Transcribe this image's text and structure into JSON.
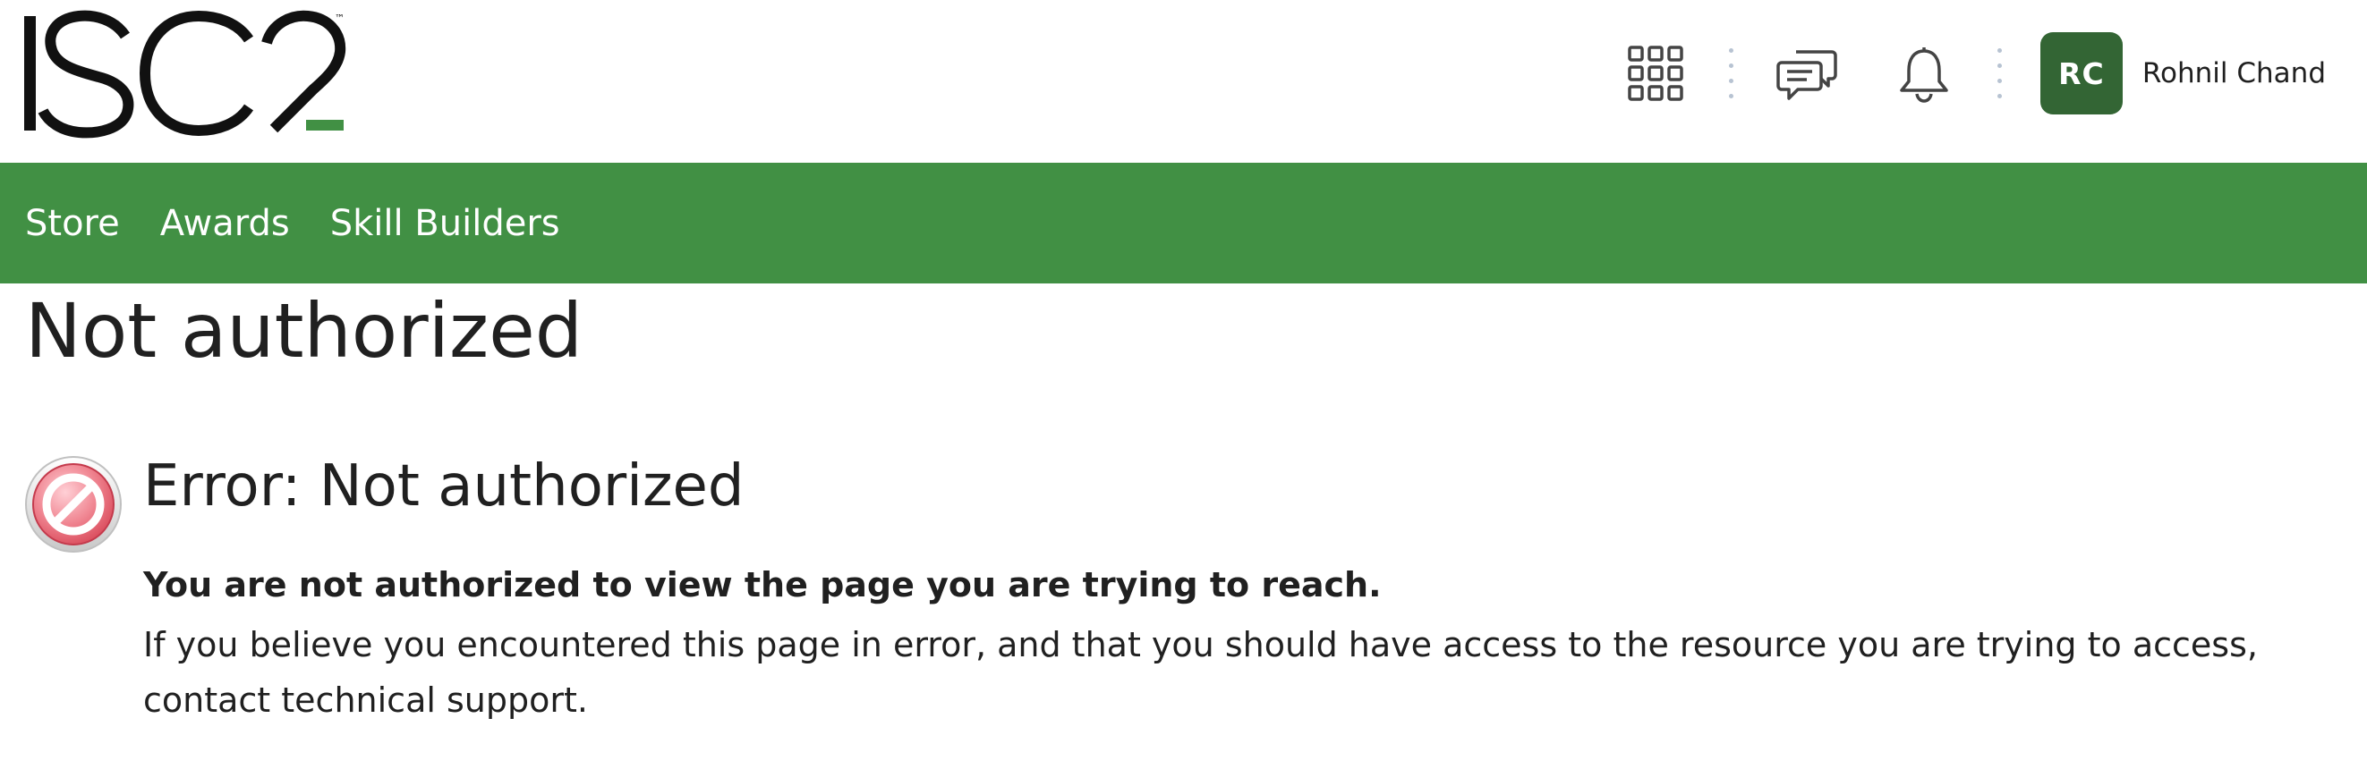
{
  "brand": {
    "logo_text": "ISC2",
    "trademark": "™",
    "accent_color": "#419044"
  },
  "header": {
    "icons": [
      "app-launcher-icon",
      "chat-icon",
      "bell-icon"
    ],
    "user": {
      "initials": "RC",
      "name": "Rohnil Chand",
      "avatar_color": "#336534"
    }
  },
  "nav": {
    "items": [
      {
        "label": "Store"
      },
      {
        "label": "Awards"
      },
      {
        "label": "Skill Builders"
      }
    ]
  },
  "page": {
    "title": "Not authorized"
  },
  "error": {
    "heading": "Error: Not authorized",
    "message_bold": "You are not authorized to view the page you are trying to reach.",
    "message": "If you believe you encountered this page in error, and that you should have access to the resource you are trying to access, contact technical support.",
    "icon": "no-entry-icon"
  }
}
